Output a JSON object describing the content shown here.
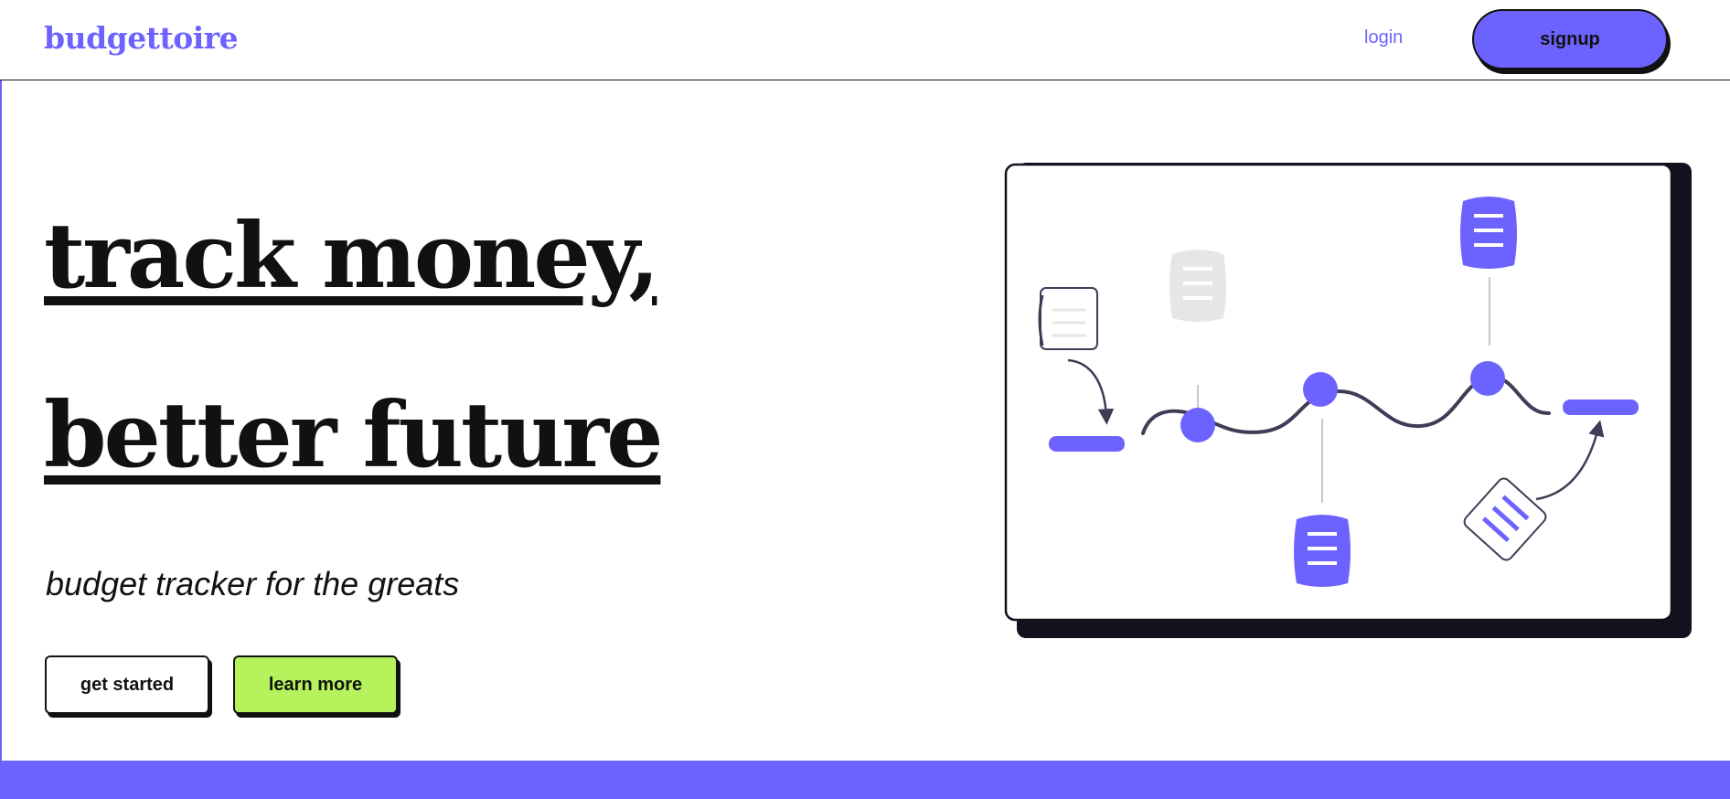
{
  "brand": {
    "name": "budgettoire",
    "accent": "#6c63ff",
    "highlight": "#b6f25b"
  },
  "nav": {
    "login_label": "login",
    "signup_label": "signup"
  },
  "hero": {
    "headline_line1": "track money,",
    "headline_line2": "better future",
    "tagline": "budget tracker for the greats",
    "cta_primary": "get started",
    "cta_secondary": "learn more"
  },
  "illustration": {
    "icons": [
      "timeline-wave-icon",
      "document-icon",
      "arrow-icon"
    ]
  }
}
